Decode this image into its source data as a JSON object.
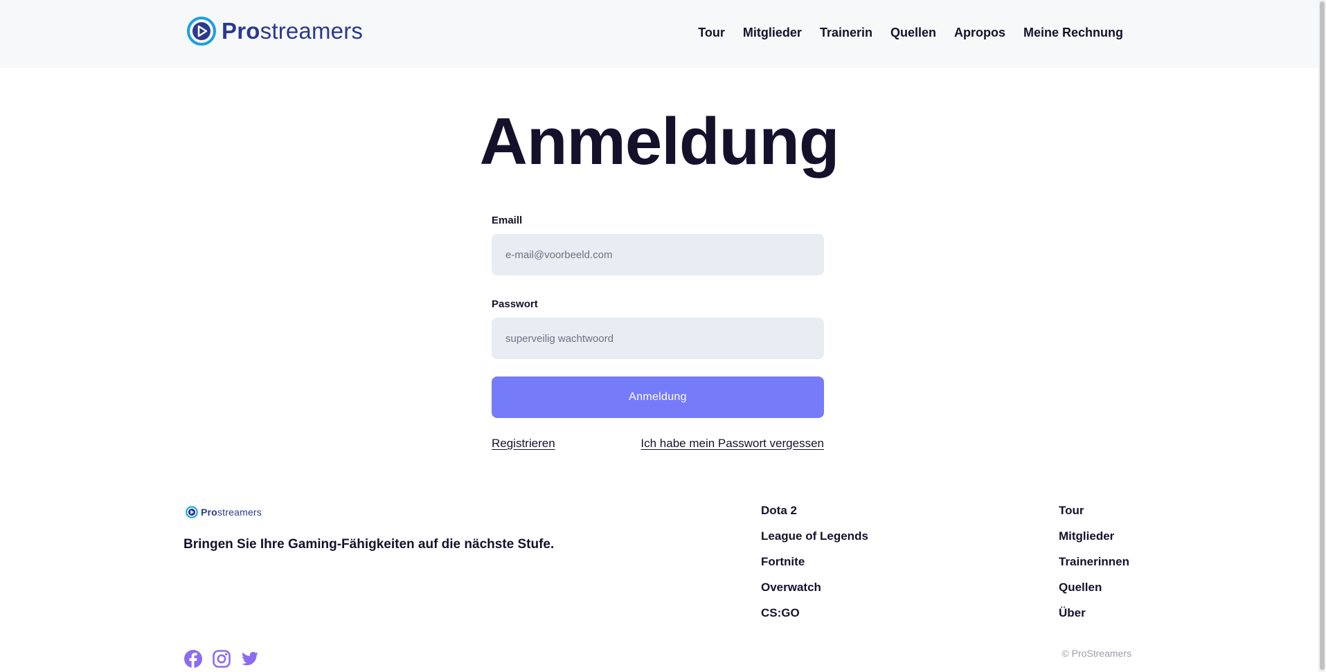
{
  "brand": {
    "name_bold": "Pro",
    "name_rest": "streamers",
    "color": "#2a3a8c",
    "accent": "#1aa0e0"
  },
  "nav": [
    "Tour",
    "Mitglieder",
    "Trainerin",
    "Quellen",
    "Apropos",
    "Meine Rechnung"
  ],
  "page_title": "Anmeldung",
  "form": {
    "email_label": "Emaill",
    "email_placeholder": "e-mail@voorbeeld.com",
    "password_label": "Passwort",
    "password_placeholder": "superveilig wachtwoord",
    "submit_label": "Anmeldung",
    "register_link": "Registrieren",
    "forgot_link": "Ich habe mein Passwort vergessen"
  },
  "footer": {
    "tagline": "Bringen Sie Ihre Gaming-Fähigkeiten auf die nächste Stufe.",
    "games": [
      "Dota 2",
      "League of Legends",
      "Fortnite",
      "Overwatch",
      "CS:GO"
    ],
    "site_links": [
      "Tour",
      "Mitglieder",
      "Trainerinnen",
      "Quellen",
      "Über"
    ],
    "copyright": "© ProStreamers",
    "social": [
      "facebook-icon",
      "instagram-icon",
      "twitter-icon"
    ],
    "social_color": "#8b6cf0"
  },
  "colors": {
    "button": "#767bfa",
    "input_bg": "#e8ecf3",
    "header_bg": "#f7f8fa",
    "text": "#15112b"
  }
}
